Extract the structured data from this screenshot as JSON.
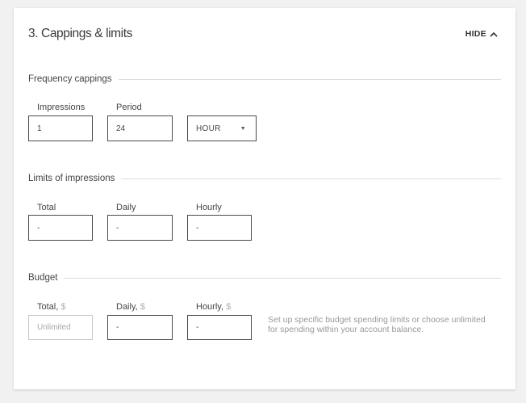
{
  "card": {
    "title": "3. Cappings & limits",
    "hide_label": "HIDE",
    "hide_icon": "chevron-up-icon"
  },
  "frequency": {
    "heading": "Frequency cappings",
    "impressions_label": "Impressions",
    "impressions_value": "1",
    "period_label": "Period",
    "period_value": "24",
    "period_unit": "HOUR",
    "period_unit_icon": "caret-down-icon"
  },
  "limits": {
    "heading": "Limits of impressions",
    "total_label": "Total",
    "total_value": "-",
    "daily_label": "Daily",
    "daily_value": "-",
    "hourly_label": "Hourly",
    "hourly_value": "-"
  },
  "budget": {
    "heading": "Budget",
    "total_label": "Total,",
    "daily_label": "Daily,",
    "hourly_label": "Hourly,",
    "currency": "$",
    "total_placeholder": "Unlimited",
    "daily_value": "-",
    "hourly_value": "-",
    "hint": "Set up specific budget spending limits or choose unlimited for spending within your account balance."
  },
  "colors": {
    "page_bg": "#f1f1f1",
    "card_bg": "#ffffff",
    "field_border": "#4a4a4a",
    "muted_text": "#9a9a9a"
  }
}
